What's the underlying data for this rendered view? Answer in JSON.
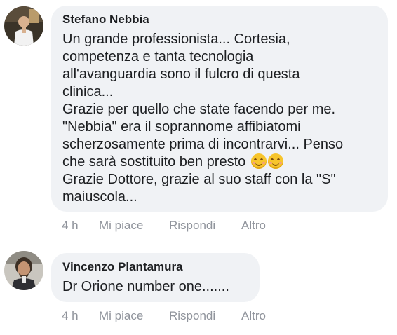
{
  "comments": [
    {
      "author": "Stefano Nebbia",
      "lines": [
        "Un grande professionista... Cortesia,",
        "competenza e tanta tecnologia",
        "all'avanguardia sono il fulcro di questa",
        "clinica...",
        "Grazie per quello che state facendo per me.",
        "\"Nebbia\" era il soprannome affibiatomi",
        "scherzosamente prima di incontrarvi... Penso",
        "che sarà sostituito ben presto",
        "Grazie Dottore, grazie al suo staff con la \"S\"",
        "maiuscola..."
      ],
      "emoji": [
        "smiling-face-icon",
        "smiling-face-icon"
      ],
      "time": "4 h",
      "like_label": "Mi piace",
      "reply_label": "Rispondi",
      "more_label": "Altro"
    },
    {
      "author": "Vincenzo Plantamura",
      "lines": [
        "Dr Orione number one......."
      ],
      "time": "4 h",
      "like_label": "Mi piace",
      "reply_label": "Rispondi",
      "more_label": "Altro"
    }
  ],
  "colors": {
    "bubble": "#f0f2f5",
    "text": "#1c1e21",
    "meta": "#90949c",
    "emoji": "#f7c52c"
  }
}
